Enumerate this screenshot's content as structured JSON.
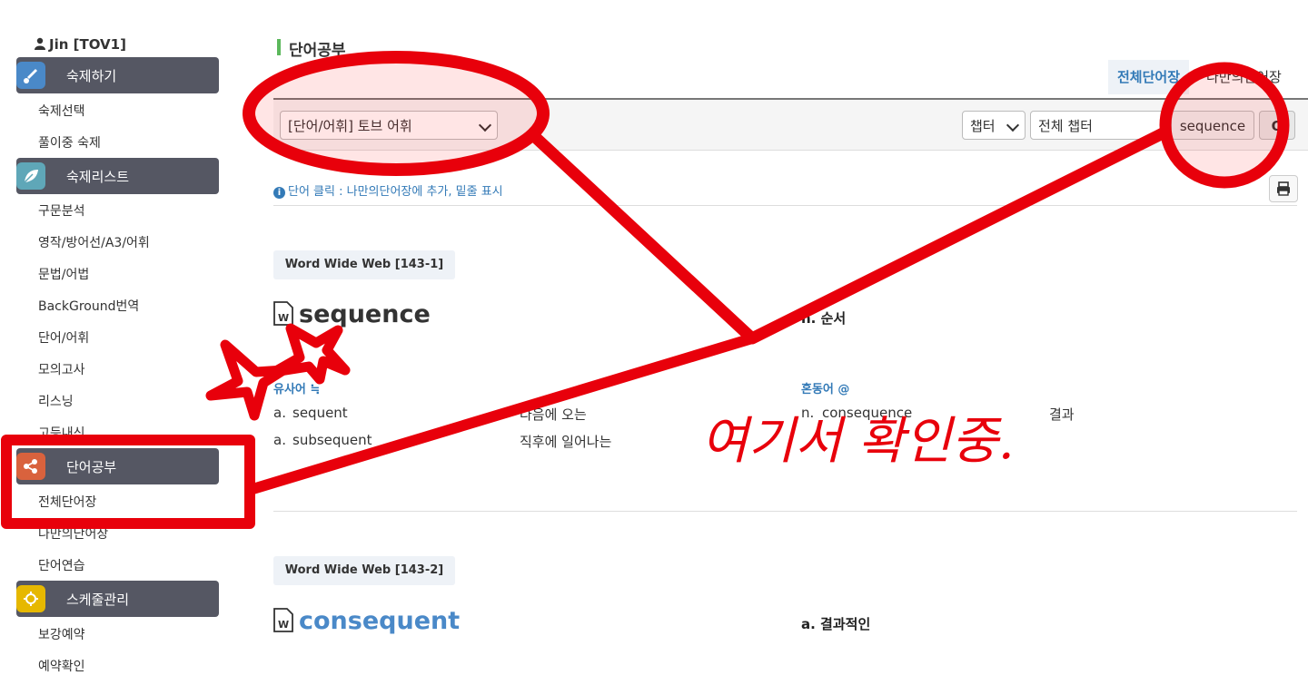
{
  "user": {
    "name": "Jin [TOV1]"
  },
  "sidebar": {
    "sections": [
      {
        "label": "숙제하기",
        "icon": "brush-icon",
        "color": "#4a89c8"
      },
      {
        "label": "숙제리스트",
        "icon": "leaf-icon",
        "color": "#5fa7b8"
      },
      {
        "label": "단어공부",
        "icon": "share-icon",
        "color": "#d9623d"
      },
      {
        "label": "스케줄관리",
        "icon": "crosshair-icon",
        "color": "#e6b800"
      }
    ],
    "homework_items": [
      "숙제선택",
      "풀이중 숙제"
    ],
    "list_items": [
      "구문분석",
      "영작/방어선/A3/어휘",
      "문법/어법",
      "BackGround번역",
      "단어/어휘",
      "모의고사",
      "리스닝",
      "고등내신"
    ],
    "word_items": [
      "전체단어장",
      "나만의단어장",
      "단어연습"
    ],
    "schedule_items": [
      "보강예약",
      "예약확인"
    ]
  },
  "page": {
    "title": "단어공부",
    "tabs": [
      "전체단어장",
      "나만의단어장"
    ],
    "category_select": "[단어/어휘] 토브 어휘",
    "chapter_select": "챕터",
    "chapter_value": "전체 챕터",
    "search_value": "sequence",
    "search_button": "Q",
    "info_text": "단어 클릭 : 나만의단어장에 추가, 밑줄 표시"
  },
  "entries": [
    {
      "source": "Word Wide Web [143-1]",
      "word": "sequence",
      "meaning": "n. 순서",
      "synonym_label": "유사어 ≒",
      "synonyms": [
        {
          "pos": "a.",
          "word": "sequent",
          "meaning": "다음에 오는"
        },
        {
          "pos": "a.",
          "word": "subsequent",
          "meaning": "직후에 일어나는"
        }
      ],
      "confusable_label": "혼동어 @",
      "confusables": [
        {
          "pos": "n.",
          "word": "consequence",
          "meaning": "결과"
        }
      ]
    },
    {
      "source": "Word Wide Web [143-2]",
      "word": "consequent",
      "meaning": "a. 결과적인"
    }
  ],
  "annotation": {
    "handwritten_note": "여기서 확인중."
  },
  "colors": {
    "accent": "#337ab7",
    "annotation": "#e8000b",
    "title_bar": "#5cb85c",
    "sidebar_head": "#555763"
  }
}
